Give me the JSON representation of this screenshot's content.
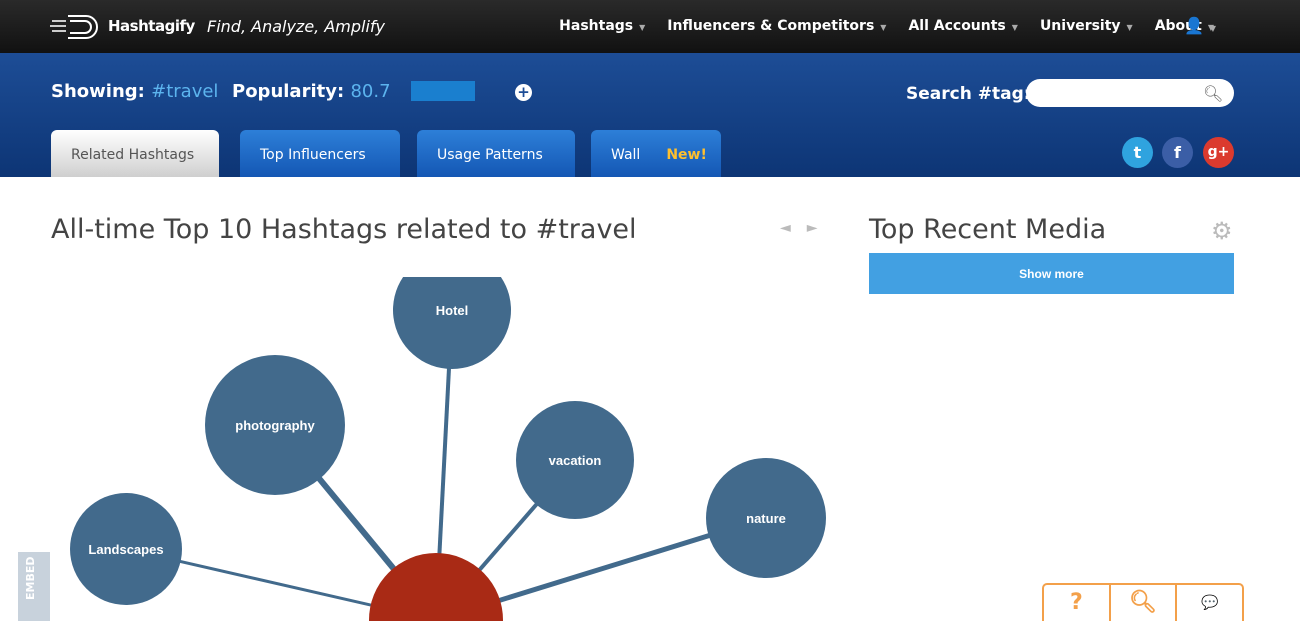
{
  "header": {
    "brand": "Hashtagify",
    "tagline": "Find, Analyze, Amplify",
    "nav": [
      "Hashtags",
      "Influencers & Competitors",
      "All Accounts",
      "University",
      "About"
    ],
    "user_icon": "user-icon"
  },
  "band": {
    "showing_label": "Showing:",
    "hashtag": "#travel",
    "popularity_label": "Popularity:",
    "popularity": "80.7",
    "search_label": "Search #tag:",
    "search_value": ""
  },
  "tabs": [
    {
      "label": "Related Hashtags"
    },
    {
      "label": "Top Influencers"
    },
    {
      "label": "Usage Patterns"
    },
    {
      "label": "Wall",
      "badge": "New!"
    }
  ],
  "social": {
    "twitter": "t",
    "facebook": "f",
    "google": "g+",
    "colors": {
      "twitter": "#2fa3df",
      "facebook": "#3b5ea6",
      "google": "#db3a2e"
    }
  },
  "main": {
    "title": "All-time Top 10 Hashtags related to #travel",
    "prev": "◄",
    "next": "►"
  },
  "side": {
    "title": "Top Recent Media",
    "show_more": "Show more"
  },
  "graph": {
    "center_color": "#a92a15",
    "node_color": "#426a8c",
    "nodes": [
      {
        "label": "Hotel"
      },
      {
        "label": "photography"
      },
      {
        "label": "vacation"
      },
      {
        "label": "nature"
      },
      {
        "label": "Landscapes"
      }
    ]
  },
  "embed": "EMBED",
  "help": {
    "question": "?",
    "search": "search-icon",
    "support": "support-agent-icon"
  }
}
